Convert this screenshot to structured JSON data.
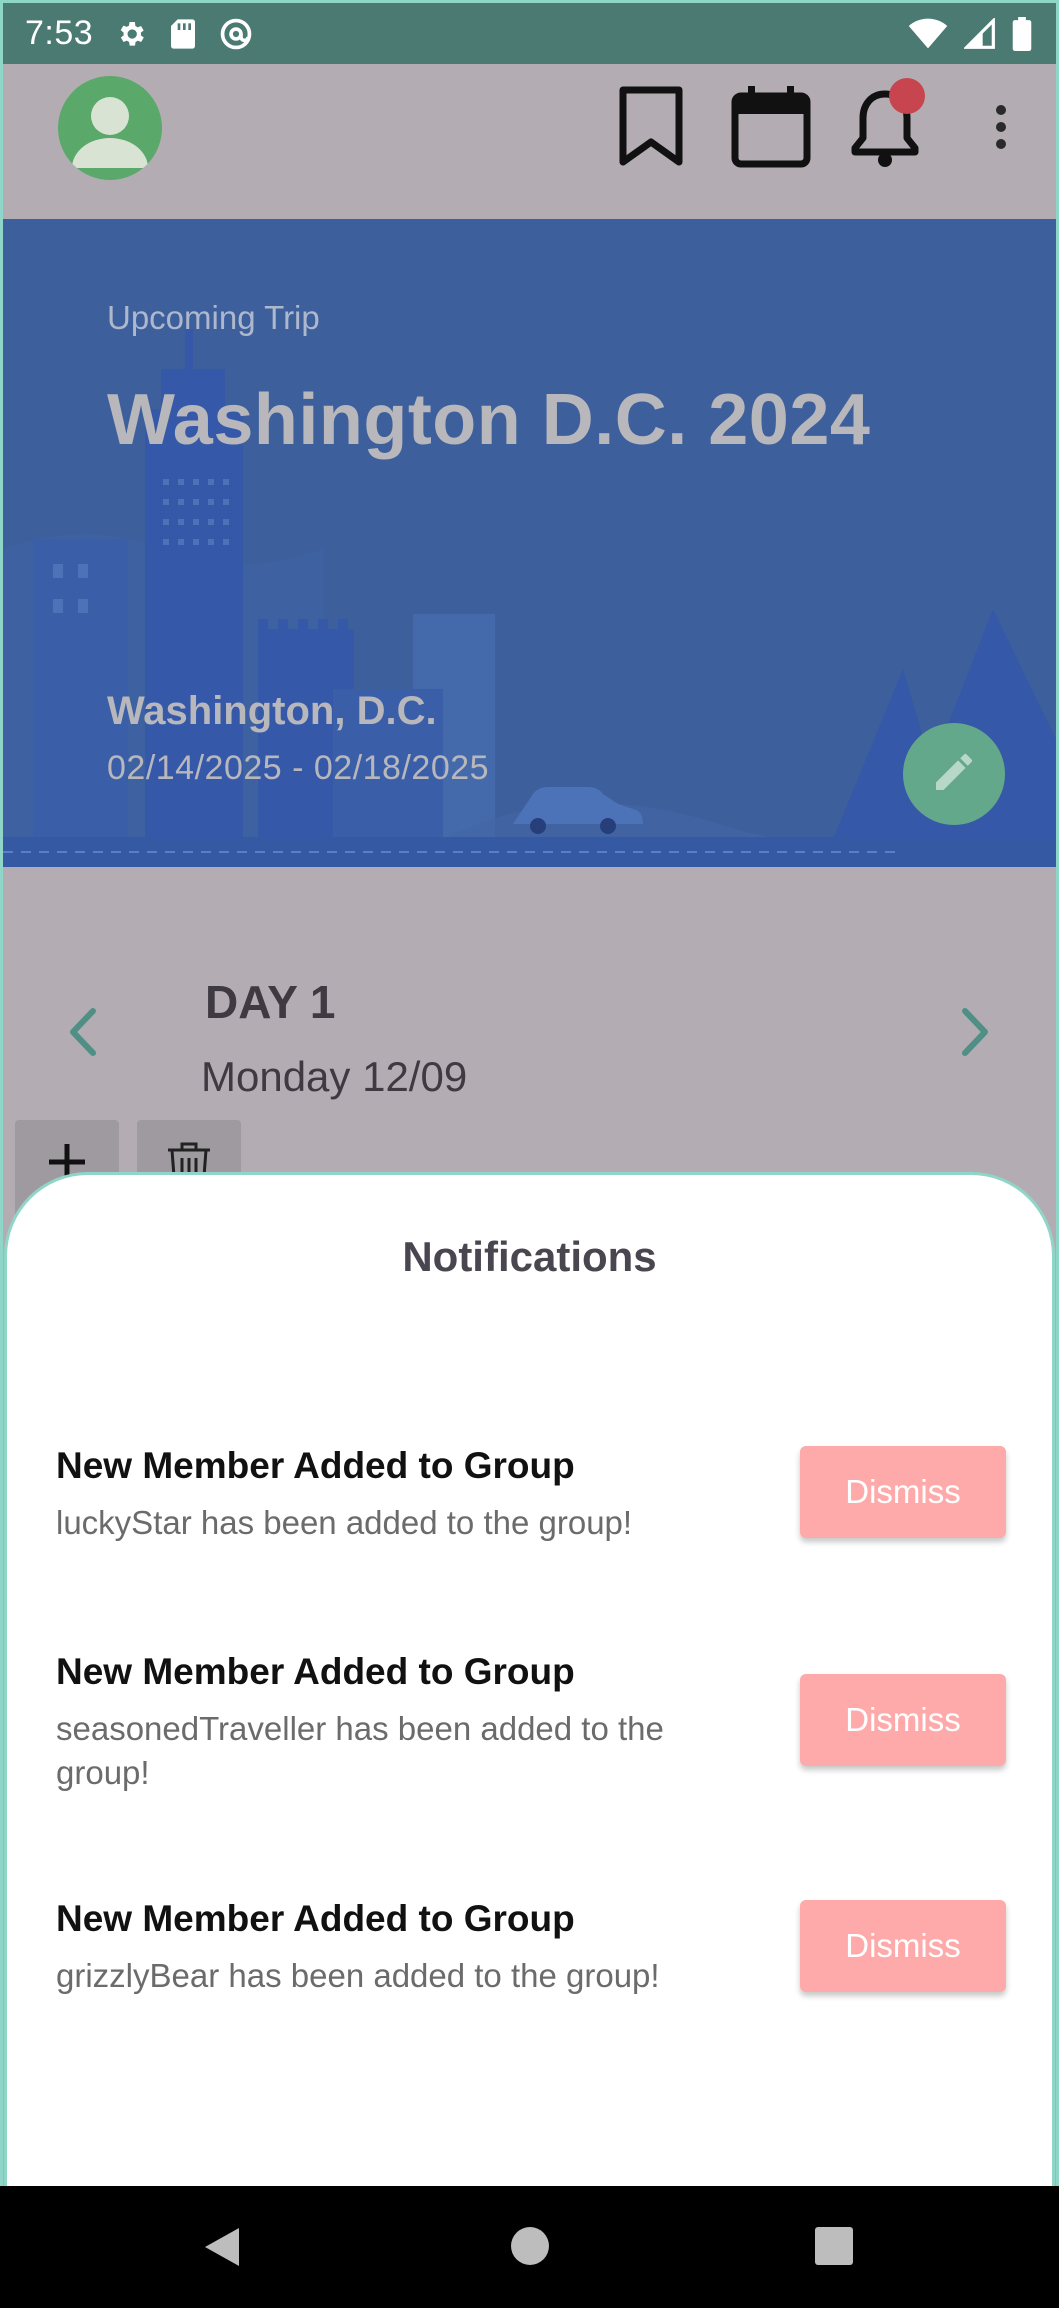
{
  "status_bar": {
    "time": "7:53",
    "icons": [
      "gear-icon",
      "sd-card-icon",
      "at-sign-icon",
      "wifi-icon",
      "signal-icon",
      "battery-icon"
    ]
  },
  "toolbar": {
    "icons": [
      "profile-avatar-icon",
      "bookmark-icon",
      "calendar-icon",
      "bell-icon",
      "more-vert-icon"
    ],
    "has_unread_notifications": true
  },
  "trip": {
    "label": "Upcoming Trip",
    "title": "Washington D.C. 2024",
    "city": "Washington, D.C.",
    "dates": "02/14/2025 - 02/18/2025"
  },
  "day_nav": {
    "day_label": "DAY 1",
    "date": "Monday 12/09"
  },
  "notifications_sheet": {
    "title": "Notifications",
    "dismiss_label": "Dismiss",
    "items": [
      {
        "title": "New Member Added to Group",
        "body": "luckyStar has been added to the group!"
      },
      {
        "title": "New Member Added to Group",
        "body": "seasonedTraveller has been added to the group!"
      },
      {
        "title": "New Member Added to Group",
        "body": "grizzlyBear has been added to the group!"
      }
    ]
  },
  "colors": {
    "accent": "#64a88c",
    "hero_blue": "#3d5f9c",
    "dismiss_button": "#ffaaaa",
    "status_bar": "#4a7a72",
    "badge": "#c7454f"
  }
}
